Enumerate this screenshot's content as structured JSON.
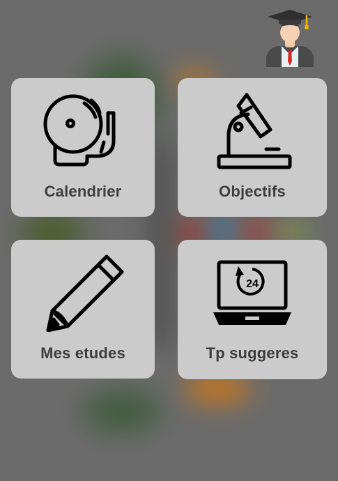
{
  "avatar": {
    "icon": "graduate-avatar-icon"
  },
  "menu": {
    "items": [
      {
        "label": "Calendrier",
        "icon": "bell-icon"
      },
      {
        "label": "Objectifs",
        "icon": "microscope-icon"
      },
      {
        "label": "Mes etudes",
        "icon": "pencil-icon"
      },
      {
        "label": "Tp suggeres",
        "icon": "laptop-24-icon"
      }
    ]
  },
  "colors": {
    "background": "#6b6b6b",
    "tile": "#cbcbcb",
    "label": "#3d3d3d",
    "icon": "#000000"
  },
  "icons": {
    "laptop_badge_text": "24"
  }
}
